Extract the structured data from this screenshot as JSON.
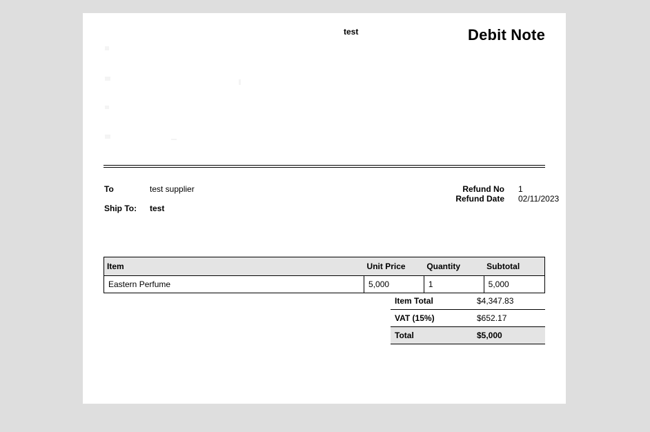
{
  "header": {
    "company_name": "test",
    "document_title": "Debit Note"
  },
  "parties": {
    "to_label": "To",
    "to_value": "test supplier",
    "ship_to_label": "Ship To:",
    "ship_to_value": "test"
  },
  "meta": {
    "refund_no_label": "Refund No",
    "refund_no_value": "1",
    "refund_date_label": "Refund Date",
    "refund_date_value": "02/11/2023"
  },
  "items_table": {
    "headers": {
      "item": "Item",
      "unit_price": "Unit Price",
      "quantity": "Quantity",
      "subtotal": "Subtotal"
    },
    "rows": [
      {
        "item": "Eastern Perfume",
        "unit_price": "5,000",
        "quantity": "1",
        "subtotal": "5,000"
      }
    ]
  },
  "totals": {
    "item_total_label": "Item Total",
    "item_total_value": "$4,347.83",
    "vat_label": "VAT (15%)",
    "vat_value": "$652.17",
    "total_label": "Total",
    "total_value": "$5,000"
  }
}
